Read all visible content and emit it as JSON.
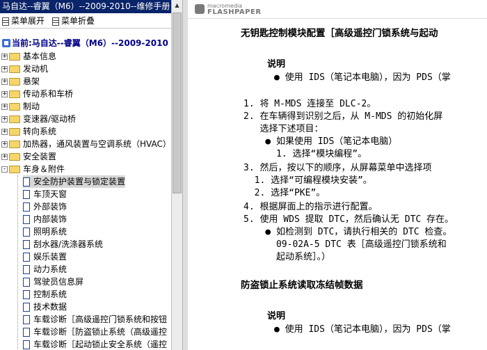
{
  "window": {
    "title": "马自达--睿翼（M6）--2009-2010--维修手册"
  },
  "toolbar": {
    "expand_label": "菜单展开",
    "collapse_label": "菜单折叠"
  },
  "tree": {
    "current_label": "当前:马自达--睿翼（M6）--2009-2010",
    "folders": [
      {
        "label": "基本信息",
        "state": "+"
      },
      {
        "label": "发动机",
        "state": "+"
      },
      {
        "label": "悬架",
        "state": "+"
      },
      {
        "label": "传动系和车桥",
        "state": "+"
      },
      {
        "label": "制动",
        "state": "+"
      },
      {
        "label": "变速器/驱动桥",
        "state": "+"
      },
      {
        "label": "转向系统",
        "state": "+"
      },
      {
        "label": "加热器，通风装置与空调系统（HVAC）",
        "state": "+"
      },
      {
        "label": "安全装置",
        "state": "+"
      },
      {
        "label": "车身＆附件",
        "state": "-"
      }
    ],
    "children": [
      "安全防护装置与锁定装置",
      "车顶天窗",
      "外部装饰",
      "内部装饰",
      "照明系统",
      "刮水器/洗涤器系统",
      "娱乐装置",
      "动力系统",
      "驾驶员信息屏",
      "控制系统",
      "技术数据",
      "车载诊断［高级遥控门锁系统和按钮",
      "车载诊断［防盗锁止系统（高级遥控",
      "车载诊断［起动锁止安全系统（遥控"
    ]
  },
  "viewer": {
    "brand_small": "macromedia",
    "brand_big": "FLASHPAPER",
    "heading1": "无钥匙控制模块配置［高级遥控门锁系统与起动",
    "note_title": "说明",
    "note_bullet": "● 使用 IDS（笔记本电脑），因为 PDS（掌",
    "steps": [
      "1. 将 M-MDS 连接至 DLC-2。",
      "2. 在车辆得到识别之后，从 M-MDS 的初始化屏",
      "   选择下述项目：",
      "    ● 如果使用 IDS（笔记本电脑）",
      "      1. 选择“模块编程”。",
      "3. 然后，按以下的顺序，从屏幕菜单中选择项",
      "  1. 选择“可编程模块安装”。",
      "  2. 选择“PKE”。",
      "4. 根据屏面上的指示进行配置。",
      "5. 使用 WDS 提取 DTC，然后确认无 DTC 存在。",
      "    ● 如检测到 DTC，请执行相关的 DTC 检查。",
      "      09-02A-5 DTC 表［高级遥控门锁系统和",
      "      起动系统］。）"
    ],
    "heading2": "防盗锁止系统读取冻结帧数据",
    "note2_title": "说明",
    "note2_bullet": "● 使用 IDS（笔记本电脑），因为 PDS（掌"
  }
}
